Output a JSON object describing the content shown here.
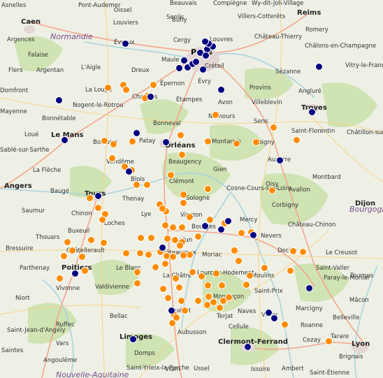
{
  "map": {
    "colors": {
      "land": "#eef0e6",
      "forest": "#cfe3b3",
      "urban": "#e3d6d2",
      "water": "#aad3df",
      "road_major": "#f4a58a",
      "road_minor": "#f8d38a",
      "marker_orange": "#ff8c00",
      "marker_navy": "#00007f"
    },
    "place_labels": [
      "Asnelles",
      "Pont-Audemer",
      "Oissel",
      "Beauvais",
      "Compiègne",
      "Senlis",
      "Villers-Cotterêts",
      "Reims",
      "Romery",
      "Caen",
      "Louviers",
      "Buhy",
      "Wy-dit-Joli-Village",
      "Argences",
      "Évreux",
      "Cergy",
      "Louvres",
      "Château-Thierry",
      "Normandie",
      "Châlons-en-Champagne",
      "Falaise",
      "Maule",
      "Paris",
      "Vitry-le-François",
      "Flers",
      "Argentan",
      "L'Aigle",
      "Dreux",
      "Créteil",
      "Épernon",
      "Évry",
      "Provins",
      "Sézanne",
      "Domfront",
      "La Loupe",
      "Chartres",
      "Angluré",
      "Nogent-le-Rotrou",
      "Étampes",
      "Avon",
      "Villeblevin",
      "Troyes",
      "Mayenne",
      "Bonnétable",
      "Bonneval",
      "Nemours",
      "Sens",
      "Le Mans",
      "Saint-Florentin",
      "Loué",
      "Bouloire",
      "Patay",
      "Orléans",
      "Montargis",
      "Joigny",
      "Châtillon-sur-Seine",
      "Sablé-sur-Sarthe",
      "Vendôme",
      "Beaugency",
      "Auxerre",
      "La Flèche",
      "Gien",
      "Montbard",
      "Angers",
      "Blois",
      "Clémont",
      "Oisy",
      "Avallon",
      "Baugé",
      "Cosne-Cours-sur-Loire",
      "Dijon",
      "Saumur",
      "Tours",
      "Thenay",
      "Sologne",
      "Corbigny",
      "Chinon",
      "Loches",
      "Vierzon",
      "Mercy",
      "Lye",
      "Château-Chinon",
      "Bourgogne-Franche-Comté",
      "Buxeuil",
      "Bourges",
      "Nevers",
      "Thouars",
      "Châtellerault",
      "Châteauroux",
      "Issoudun",
      "Decize",
      "Le Creusot",
      "Bressuire",
      "Parthenay",
      "Poitiers",
      "Le Blanc",
      "La Châtre",
      "Moriac",
      "Louroux-Hodement",
      "Moulins",
      "Saint-Valler",
      "Paray-le-Monial",
      "Tournus",
      "Vivonne",
      "Valdivienne",
      "Montluçon",
      "Saint-Prix",
      "Niort",
      "Bellac",
      "Guéret",
      "Terjat",
      "Naves",
      "Marcigny",
      "Mâcon",
      "Vichy",
      "Ruffec",
      "Roanne",
      "Belleville",
      "Saint-Jean-d'Angély",
      "Cellule",
      "Aubusson",
      "Vars",
      "Limoges",
      "Cezay",
      "Clermont-Ferrand",
      "Tarare",
      "Lyon",
      "Saintes",
      "Angoulême",
      "Domps",
      "Brignais",
      "Saint-Yrieix-la-Perche",
      "Viam",
      "Ussel",
      "Issoire",
      "Ambert",
      "Saint-Étienne",
      "Nouvelle-Aquitaine"
    ],
    "marker_groups": [
      {
        "name": "orange",
        "color": "#ff8c00",
        "count": 100
      },
      {
        "name": "navy",
        "color": "#00007f",
        "count": 36
      }
    ]
  }
}
